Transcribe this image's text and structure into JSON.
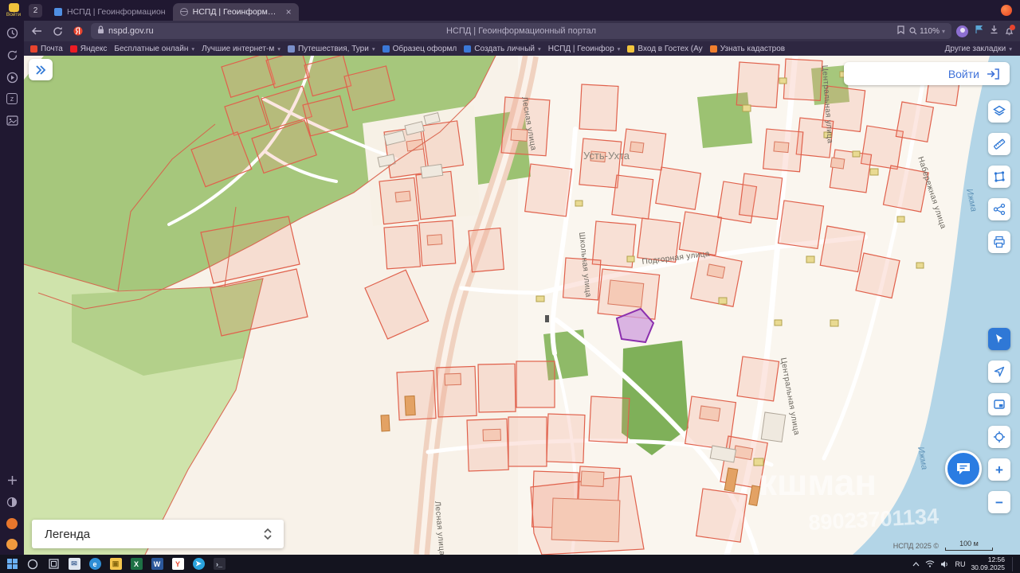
{
  "browser": {
    "profile": {
      "label": "Войти"
    },
    "tab_counter": "2",
    "tabs": [
      {
        "title": "НСПД | Геоинформацион"
      },
      {
        "title": "НСПД | Геоинформац..."
      }
    ],
    "address_bar": {
      "domain": "nspd.gov.ru",
      "page_title": "НСПД | Геоинформационный портал",
      "zoom": "110%"
    },
    "bookmarks": [
      {
        "label": "Почта",
        "color": "#e8442e"
      },
      {
        "label": "Яндекс",
        "color": "#ec1c24"
      },
      {
        "label": "Бесплатные онлайн",
        "color": "#8d87a0"
      },
      {
        "label": "Лучшие интернет-м",
        "color": "#8d87a0"
      },
      {
        "label": "Путешествия, Тури",
        "color": "#7a8fc9"
      },
      {
        "label": "Образец оформл",
        "color": "#3b78d8"
      },
      {
        "label": "Создать личный",
        "color": "#3b78d8"
      },
      {
        "label": "НСПД | Геоинфор",
        "color": "#8d87a0"
      },
      {
        "label": "Вход в Гостех (Ау",
        "color": "#f2c53d"
      },
      {
        "label": "Узнать кадастров",
        "color": "#f07f2e"
      }
    ],
    "other_bookmarks": "Другие закладки"
  },
  "map": {
    "login_button": "Войти",
    "legend": "Легенда",
    "place": "Усть-Ухта",
    "streets": {
      "lesnaya_top": "Лесная улица",
      "lesnaya_bottom": "Лесная улица",
      "shkolnaya": "Школьная улица",
      "podgornaya": "Подгорная улица",
      "tsentralnaya_top": "Центральная улица",
      "tsentralnaya_mid": "Центральная улица",
      "naberezhnaya": "Набережная улица"
    },
    "river_top": "Ижма",
    "river_bottom": "Ижма",
    "watermark": {
      "name": "кшман",
      "phone": "89023701134"
    },
    "attribution": "НСПД 2025 ©",
    "scale": "100 м",
    "zoom_in": "+",
    "zoom_out": "−"
  },
  "taskbar": {
    "language": "RU",
    "time": "12:56",
    "date": "30.09.2025"
  }
}
